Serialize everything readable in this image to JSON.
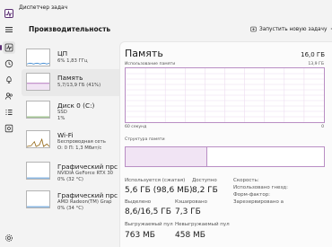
{
  "window": {
    "title": "Диспетчер задач",
    "accent": "#5b2f73"
  },
  "nav": {
    "icons": [
      "menu-icon",
      "performance-icon",
      "history-icon",
      "startup-icon",
      "users-icon",
      "details-icon",
      "services-icon",
      "settings-icon"
    ],
    "active": "performance-icon"
  },
  "header": {
    "section_title": "Производительность",
    "run_task_label": "Запустить новую задачу",
    "more_label": "···"
  },
  "sidebar": {
    "items": [
      {
        "name": "ЦП",
        "line1": "6% 1,83 ГГц",
        "line2": "",
        "color": "#1a73c8",
        "level": 0.06
      },
      {
        "name": "Память",
        "line1": "5,7/13,9 ГБ (41%)",
        "line2": "",
        "color": "#8b2c9b",
        "level": 0.41
      },
      {
        "name": "Диск 0 (C:)",
        "line1": "SSD",
        "line2": "1%",
        "color": "#4a8f2b",
        "level": 0.01
      },
      {
        "name": "Wi-Fi",
        "line1": "Беспроводная сеть",
        "line2": "О: 0 П: 1,3 Мбит/с",
        "color": "#8a5a00",
        "level": 0.3
      },
      {
        "name": "Графический прс",
        "line1": "NVIDIA GeForce RTX 30",
        "line2": "0% (32 °C)",
        "color": "#1a73c8",
        "level": 0.0
      },
      {
        "name": "Графический прс",
        "line1": "AMD Radeon(TM) Grap",
        "line2": "0% (34 °C)",
        "color": "#1a73c8",
        "level": 0.0
      }
    ]
  },
  "main": {
    "title": "Память",
    "total": "16,0 ГБ",
    "usage_label": "Использование памяти",
    "usage_max": "13,9 ГБ",
    "time_label": "60 секунд",
    "zero_label": "0",
    "struct_label": "Структура памяти",
    "used_fraction": 0.41,
    "stats": {
      "in_use_label": "Используется (сжатая)",
      "in_use_value": "5,6 ГБ (98,6 МБ)",
      "available_label": "Доступно",
      "available_value": "8,2 ГБ",
      "committed_label": "Выделено",
      "committed_value": "8,6/16,5 ГБ",
      "cached_label": "Кэшировано",
      "cached_value": "7,3 ГБ",
      "paged_label": "Выгружаемый пул",
      "paged_value": "763 МБ",
      "nonpaged_label": "Невыгружаемый пул",
      "nonpaged_value": "458 МБ",
      "speed_label": "Скорость:",
      "slots_label": "Использовано гнезд:",
      "form_label": "Форм-фактор:",
      "reserved_label": "Зарезервировано а"
    }
  }
}
